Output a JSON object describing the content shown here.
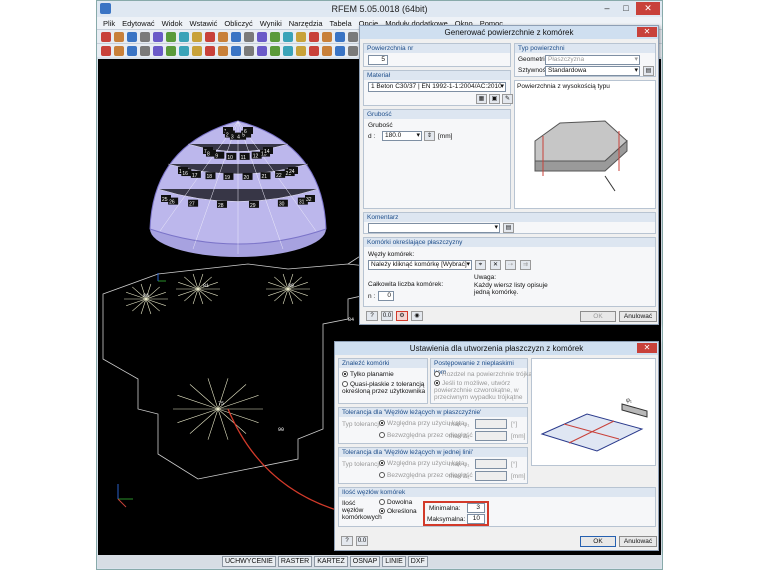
{
  "app": {
    "title": "RFEM 5.05.0018 (64bit)",
    "menu": [
      "Plik",
      "Edytować",
      "Widok",
      "Wstawić",
      "Obliczyć",
      "Wyniki",
      "Narzędzia",
      "Tabela",
      "Opcje",
      "Moduły dodatkowe",
      "Okno",
      "Pomoc"
    ],
    "status_buttons": [
      "UCHWYCENIE",
      "RASTER",
      "KARTEZ",
      "OSNAP",
      "LINIE",
      "DXF"
    ]
  },
  "dialog1": {
    "title": "Generować powierzchnie z komórek",
    "surface_no_label": "Powierzchnia nr",
    "surface_no": "5",
    "surface_type_label": "Typ powierzchni",
    "geometry_label": "Geometria:",
    "geometry_value": "Płaszczyzna",
    "stiffness_label": "Sztywność:",
    "stiffness_value": "Standardowa",
    "material_label": "Materiał",
    "material_value": "1   Beton C30/37  |  EN 1992-1-1:2004/AC:2010",
    "thickness_group": "Grubość",
    "thickness_label": "Grubość",
    "d_label": "d :",
    "d_value": "180.0",
    "d_unit": "[mm]",
    "preview_caption": "Powierzchnia z wysokością typu",
    "comment_label": "Komentarz",
    "cells_group": "Komórki określające płaszczyzny",
    "cell_nodes_label": "Węzły komórek:",
    "cell_nodes_value": "Należy kliknąć komórkę [Wybrać]",
    "total_cells_label": "Całkowita liczba komórek:",
    "n_label": "n :",
    "n_value": "0",
    "note_label": "Uwaga:",
    "note_text": "Każdy wiersz listy opisuje jedną komórkę.",
    "ok": "OK",
    "cancel": "Anulować"
  },
  "dialog2": {
    "title": "Ustawienia dla utworzenia płaszczyzn z komórek",
    "find_cells": "Znaleźć komórki",
    "opt_plan": "Tylko planarnie",
    "opt_quasi": "Quasi-płaskie z tolerancją określoną przez użytkownika",
    "nonplanar_group": "Postępowanie z nieplaskimi kom",
    "opt_split": "Rozdzel na powierzchnie trójkątne",
    "opt_curved": "Jeśli to możliwe, utwórz powierzchnie czworokątne, w przeciwnym wypadku trójkątne",
    "tol1_group": "Tolerancja dla 'Węzłów leżących w płaszczyźnie'",
    "tol_type": "Typ tolerancji",
    "rel_angle": "Względna przy użyciu kąta",
    "abs_dist": "Bezwzględna przez odległość",
    "max_phi": "max φ₁",
    "max_delta": "max Δ₁",
    "unit_deg": "[°]",
    "unit_mm": "[mm]",
    "tol2_group": "Tolerancja dla 'Węzłów leżących w jednej linii'",
    "count_group": "Ilość węzłów komórek",
    "count_label": "Ilość węzłów komórkowych",
    "opt_any": "Dowolna",
    "opt_defined": "Określona",
    "min_label": "Minimalna:",
    "min_value": "3",
    "max_label": "Maksymalna:",
    "max_value": "10",
    "ok": "OK",
    "cancel": "Anulować"
  },
  "viewport": {
    "node_labels": [
      "1",
      "2",
      "3",
      "4",
      "5",
      "6",
      "7",
      "8",
      "9",
      "10",
      "11",
      "12",
      "13",
      "14",
      "15",
      "16",
      "17",
      "18",
      "19",
      "20",
      "21",
      "22",
      "23",
      "24",
      "25",
      "26",
      "27",
      "28",
      "29",
      "30",
      "31",
      "32"
    ],
    "floor_labels": [
      "86",
      "81",
      "89",
      "75",
      "90",
      "84"
    ]
  },
  "colors": {
    "accent": "#2560b0",
    "highlight": "#d23a2a",
    "dome": "#b9b4e8"
  }
}
